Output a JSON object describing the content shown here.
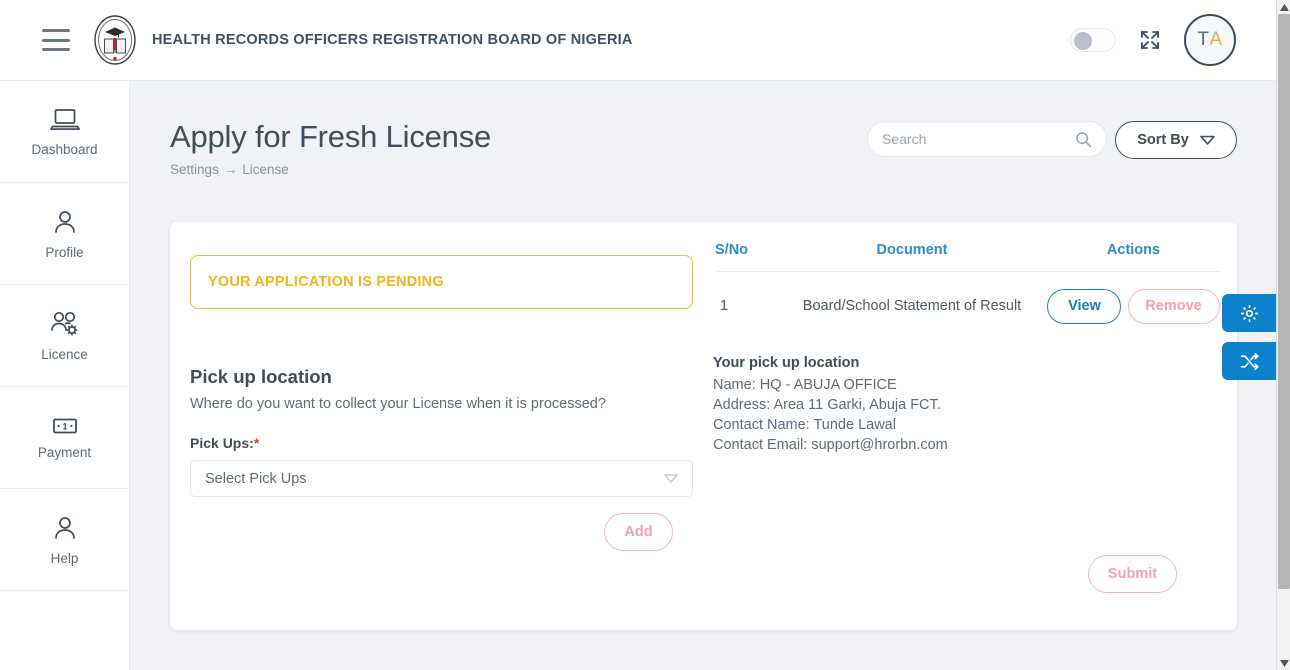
{
  "header": {
    "menu_icon": "hamburger-menu-icon",
    "logo_icon": "hrorbn-seal-logo",
    "title": "HEALTH RECORDS OFFICERS REGISTRATION BOARD OF NIGERIA",
    "theme_toggle": {
      "state": "off",
      "icon": "toggle-switch-icon"
    },
    "fullscreen_icon": "expand-fullscreen-icon",
    "avatar": {
      "initials_first": "T",
      "initials_second": "A"
    }
  },
  "sidebar": {
    "items": [
      {
        "label": "Dashboard",
        "icon": "laptop-icon"
      },
      {
        "label": "Profile",
        "icon": "user-icon"
      },
      {
        "label": "Licence",
        "icon": "users-gear-icon"
      },
      {
        "label": "Payment",
        "icon": "banknote-icon"
      },
      {
        "label": "Help",
        "icon": "user-help-icon"
      }
    ]
  },
  "page": {
    "title": "Apply for Fresh License",
    "breadcrumb_root": "Settings",
    "breadcrumb_arrow": "→",
    "breadcrumb_current": "License"
  },
  "search": {
    "value": "",
    "placeholder": "Search",
    "icon": "search-icon"
  },
  "sort": {
    "label": "Sort By",
    "icon": "chevron-down-icon"
  },
  "alert": {
    "text": "YOUR APPLICATION IS PENDING",
    "color": "#f5b41f"
  },
  "documents": {
    "columns": {
      "sno": "S/No",
      "document": "Document",
      "actions": "Actions"
    },
    "rows": [
      {
        "sno": "1",
        "document": "Board/School Statement of Result",
        "view_label": "View",
        "remove_label": "Remove"
      }
    ]
  },
  "pickup": {
    "heading": "Pick up location",
    "subtext": "Where do you want to collect your License when it is processed?",
    "field_label": "Pick Ups:",
    "required_mark": "*",
    "select_value": "Select Pick Ups",
    "select_chevron": "chevron-down-icon",
    "add_label": "Add"
  },
  "pickup_info": {
    "title": "Your pick up location",
    "name": "Name: HQ - ABUJA OFFICE",
    "address": "Address: Area 11 Garki, Abuja FCT.",
    "contact_name": "Contact Name: Tunde Lawal",
    "contact_email": "Contact Email: support@hrorbn.com"
  },
  "submit": {
    "label": "Submit"
  },
  "float_tabs": [
    {
      "name": "settings-tab",
      "icon": "gear-icon",
      "color": "#0b82cb"
    },
    {
      "name": "shuffle-tab",
      "icon": "shuffle-icon",
      "color": "#0b82cb"
    }
  ]
}
